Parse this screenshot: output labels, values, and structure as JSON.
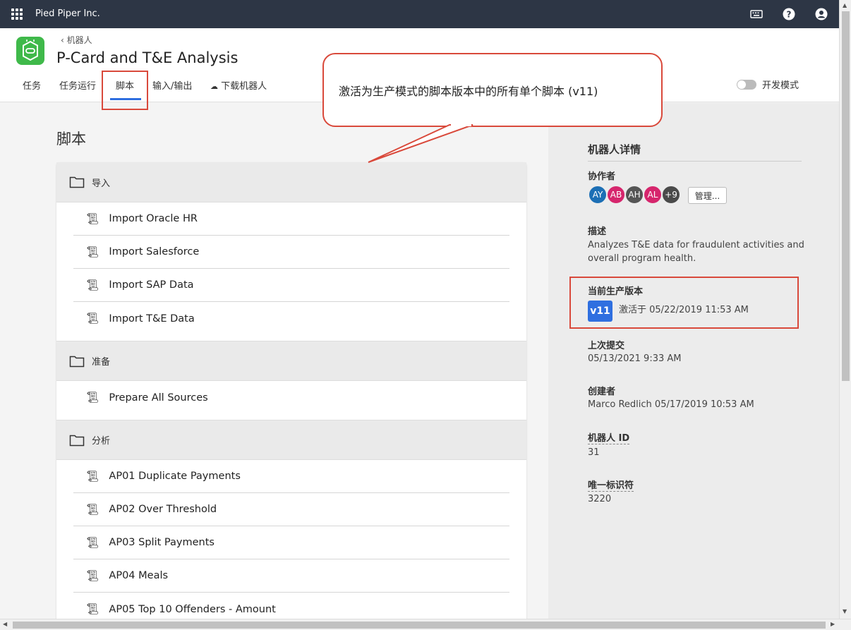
{
  "topbar": {
    "org": "Pied Piper Inc.",
    "icons": [
      "apps-icon",
      "keyboard-icon",
      "help-icon",
      "user-icon"
    ]
  },
  "header": {
    "back_label": "机器人",
    "title": "P-Card and T&E Analysis",
    "tabs": [
      "任务",
      "任务运行",
      "脚本",
      "输入/输出",
      "下载机器人"
    ],
    "active_tab": "脚本",
    "dev_mode_label": "开发模式"
  },
  "callout": {
    "text": "激活为生产模式的脚本版本中的所有单个脚本 (v11)"
  },
  "main": {
    "heading": "脚本",
    "groups": [
      {
        "folder": "导入",
        "items": [
          "Import Oracle HR",
          "Import Salesforce",
          "Import SAP Data",
          "Import T&E Data"
        ]
      },
      {
        "folder": "准备",
        "items": [
          "Prepare All Sources"
        ]
      },
      {
        "folder": "分析",
        "items": [
          "AP01 Duplicate Payments",
          "AP02 Over Threshold",
          "AP03 Split Payments",
          "AP04 Meals",
          "AP05 Top 10 Offenders - Amount"
        ]
      }
    ]
  },
  "sidebar": {
    "title": "机器人详情",
    "collaborators_label": "协作者",
    "avatars": [
      {
        "initials": "AY",
        "color": "#1c6fb5"
      },
      {
        "initials": "AB",
        "color": "#d6266d"
      },
      {
        "initials": "AH",
        "color": "#555555"
      },
      {
        "initials": "AL",
        "color": "#d6266d"
      },
      {
        "initials": "+9",
        "color": "#4a4a4a"
      }
    ],
    "manage_label": "管理...",
    "description_label": "描述",
    "description_line1": "Analyzes T&E data for fraudulent activities and",
    "description_line2": "overall program health.",
    "current_version_label": "当前生产版本",
    "version_badge": "v11",
    "activated_text": "激活于 05/22/2019 11:53 AM",
    "last_commit_label": "上次提交",
    "last_commit_value": "05/13/2021 9:33 AM",
    "creator_label": "创建者",
    "creator_value": "Marco Redlich 05/17/2019 10:53 AM",
    "robot_id_label": "机器人 ID",
    "robot_id_value": "31",
    "unique_id_label": "唯一标识符",
    "unique_id_value": "3220"
  }
}
